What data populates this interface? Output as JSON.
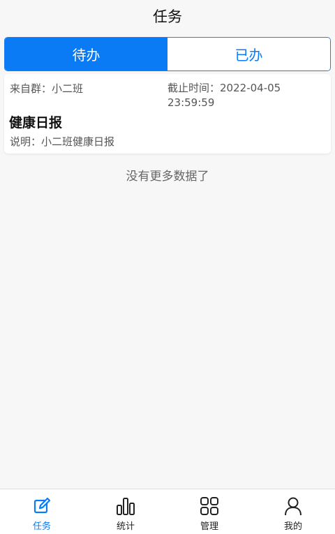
{
  "header": {
    "title": "任务"
  },
  "segmented": {
    "tabs": [
      {
        "label": "待办",
        "active": true
      },
      {
        "label": "已办",
        "active": false
      }
    ]
  },
  "task": {
    "from": "来自群：小二班",
    "deadline_label": "截止时间：",
    "deadline_value": "2022-04-05 23:59:59",
    "title": "健康日报",
    "description": "说明：小二班健康日报"
  },
  "list_status": "没有更多数据了",
  "tabbar": {
    "items": [
      {
        "label": "任务",
        "icon": "edit-icon",
        "active": true
      },
      {
        "label": "统计",
        "icon": "bar-chart-icon",
        "active": false
      },
      {
        "label": "管理",
        "icon": "grid-icon",
        "active": false
      },
      {
        "label": "我的",
        "icon": "user-icon",
        "active": false
      }
    ]
  },
  "colors": {
    "accent": "#0a7bf5",
    "background": "#f7f7f7"
  }
}
